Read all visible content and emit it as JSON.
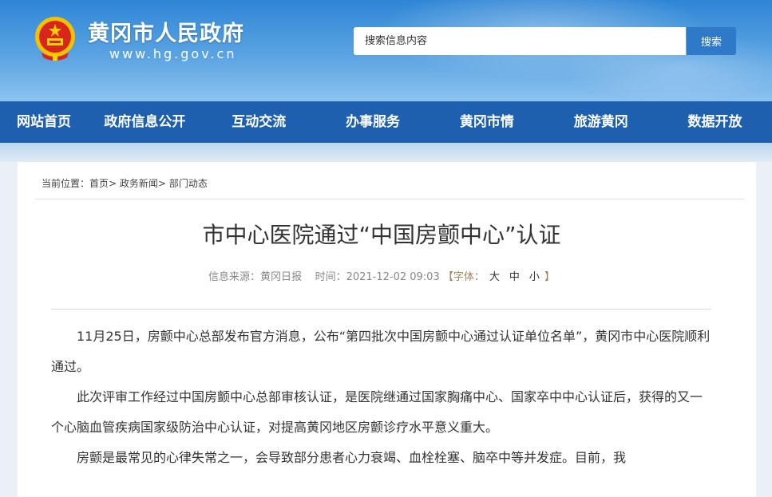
{
  "header": {
    "site_title": "黄冈市人民政府",
    "site_url": "www.hg.gov.cn",
    "search_placeholder": "搜索信息内容",
    "search_button": "搜索"
  },
  "nav": {
    "items": [
      "网站首页",
      "政府信息公开",
      "互动交流",
      "办事服务",
      "黄冈市情",
      "旅游黄冈",
      "数据开放"
    ]
  },
  "breadcrumb": {
    "prefix": "当前位置：",
    "items": [
      "首页",
      "政务新闻",
      "部门动态"
    ],
    "separator": ">"
  },
  "article": {
    "title": "市中心医院通过“中国房颤中心”认证",
    "meta_source": "信息来源：黄冈日报",
    "meta_time": "时间：2021-12-02 09:03",
    "font_size_label": "【字体：",
    "font_size_options": [
      "大",
      "中",
      "小"
    ],
    "font_size_close": "】",
    "paragraphs": [
      "11月25日，房颤中心总部发布官方消息，公布“第四批次中国房颤中心通过认证单位名单”，黄冈市中心医院顺利通过。",
      "此次评审工作经过中国房颤中心总部审核认证，是医院继通过国家胸痛中心、国家卒中中心认证后，获得的又一个心脑血管疾病国家级防治中心认证，对提高黄冈地区房颤诊疗水平意义重大。",
      "房颤是最常见的心律失常之一，会导致部分患者心力衰竭、血栓栓塞、脑卒中等并发症。目前，我"
    ]
  },
  "colors": {
    "nav_bg": "#1e5fb0",
    "search_button_bg": "#2e79c8",
    "header_gradient_top": "#2f86d6"
  }
}
